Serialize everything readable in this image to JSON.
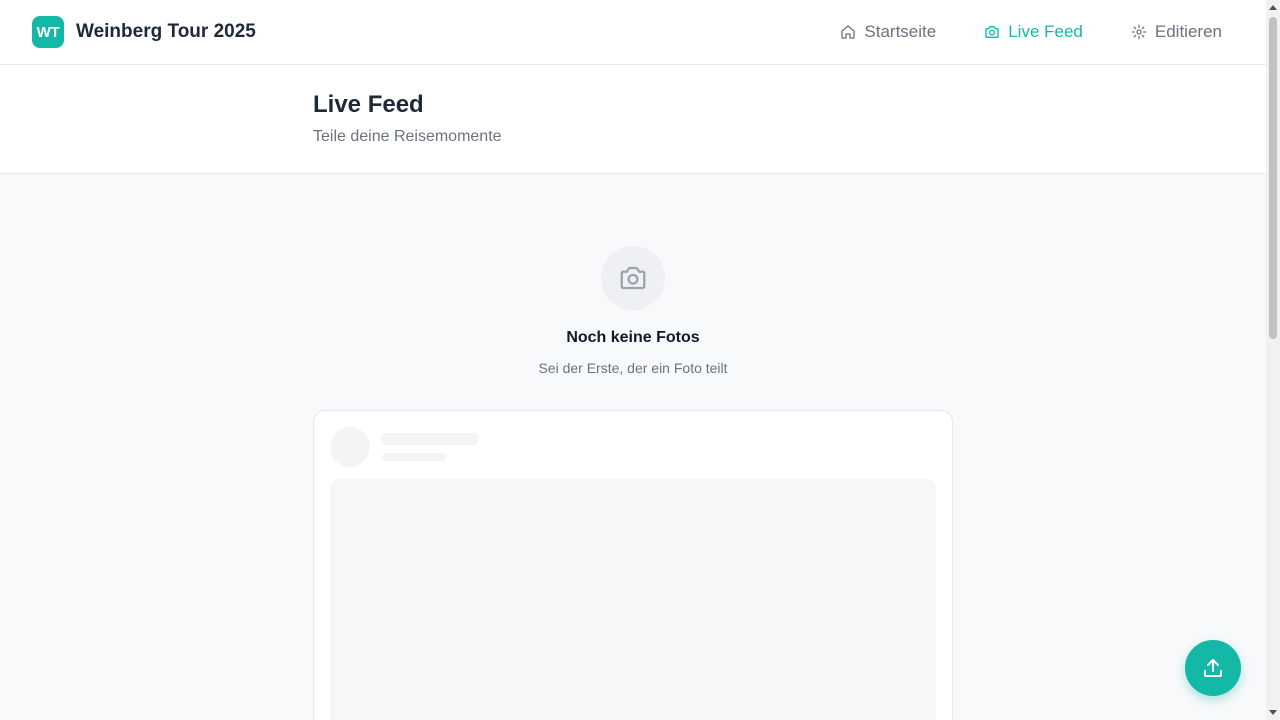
{
  "navbar": {
    "logo_text": "WT",
    "app_title": "Weinberg Tour 2025",
    "items": [
      {
        "label": "Startseite",
        "icon": "home-icon",
        "active": false
      },
      {
        "label": "Live Feed",
        "icon": "camera-icon",
        "active": true
      },
      {
        "label": "Editieren",
        "icon": "gear-icon",
        "active": false
      }
    ]
  },
  "header": {
    "title": "Live Feed",
    "subtitle": "Teile deine Reisemomente"
  },
  "empty_state": {
    "icon": "camera-icon",
    "title": "Noch keine Fotos",
    "text": "Sei der Erste, der ein Foto teilt"
  },
  "fab": {
    "icon": "upload-icon"
  },
  "colors": {
    "accent": "#14b8a6",
    "muted_text": "#6b7280",
    "background": "#f8f9fb"
  }
}
